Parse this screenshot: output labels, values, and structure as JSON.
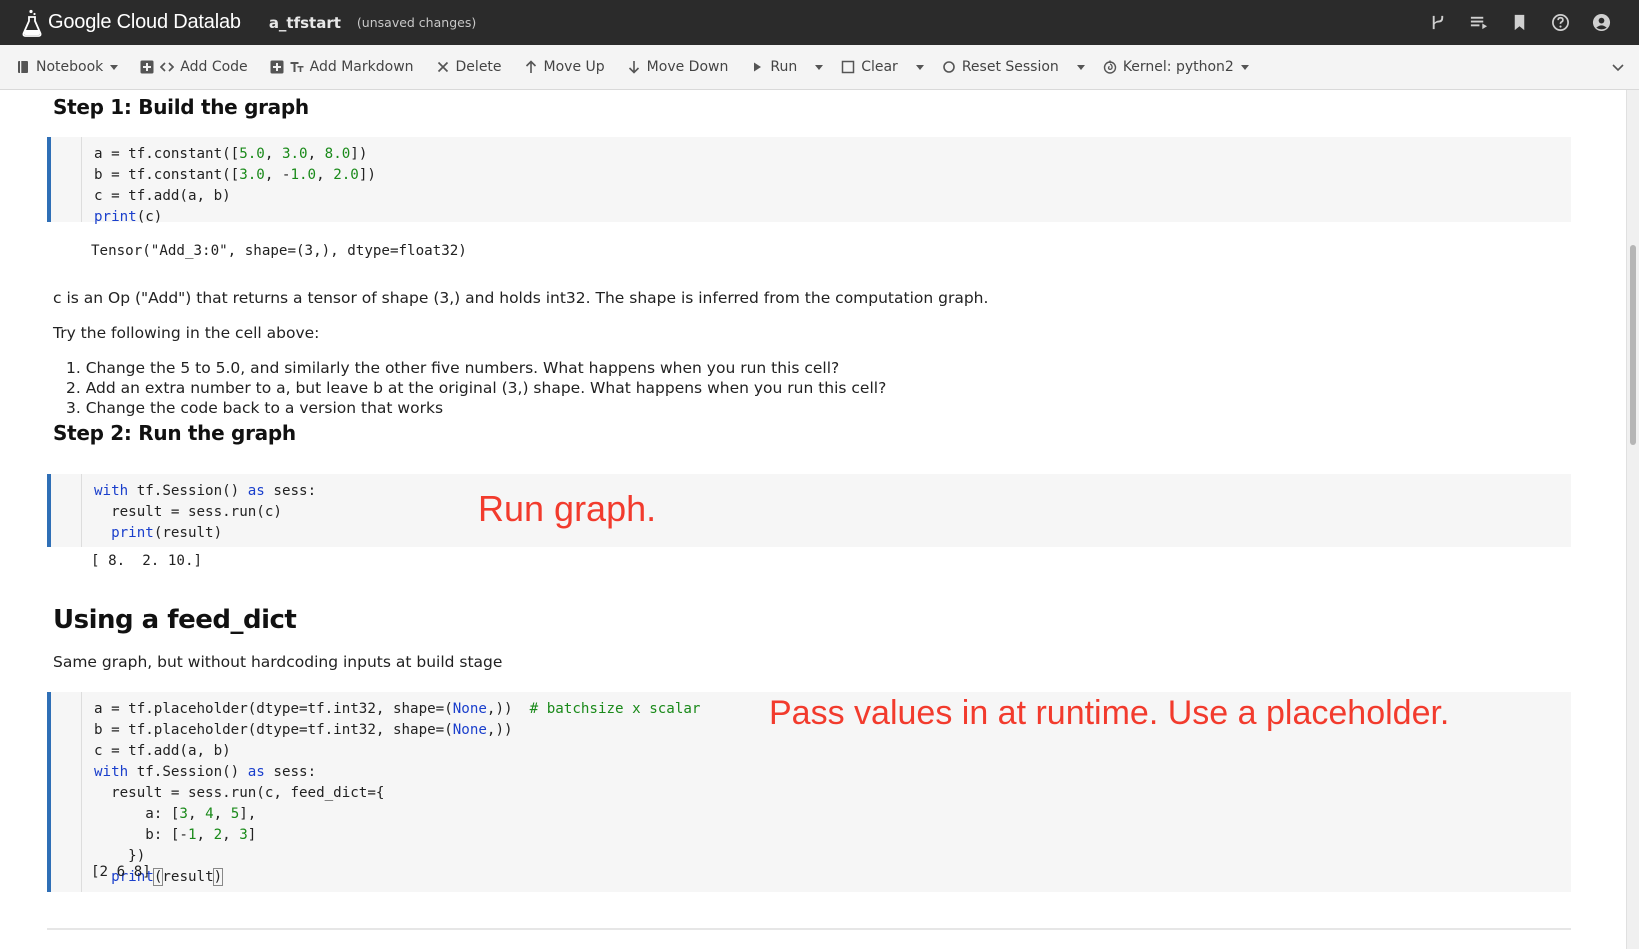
{
  "header": {
    "app_name": "Google Cloud Datalab",
    "notebook_name": "a_tfstart",
    "status": "(unsaved changes)",
    "icons": [
      "ungit-icon",
      "list-icon",
      "bookmark-icon",
      "help-icon",
      "account-icon"
    ]
  },
  "toolbar": {
    "notebook": "Notebook",
    "add_code": "Add Code",
    "add_markdown": "Add Markdown",
    "delete": "Delete",
    "move_up": "Move Up",
    "move_down": "Move Down",
    "run": "Run",
    "clear": "Clear",
    "reset_session": "Reset Session",
    "kernel": "Kernel: python2"
  },
  "step1": {
    "heading": "Step 1: Build the graph",
    "code": [
      "a = tf.constant([5.0, 3.0, 8.0])",
      "b = tf.constant([3.0, -1.0, 2.0])",
      "c = tf.add(a, b)",
      "print(c)"
    ],
    "output": "Tensor(\"Add_3:0\", shape=(3,), dtype=float32)",
    "explanation": "c is an Op (\"Add\") that returns a tensor of shape (3,) and holds int32. The shape is inferred from the computation graph.",
    "try_intro": "Try the following in the cell above:",
    "try_items": [
      "1. Change the 5 to 5.0, and similarly the other five numbers. What happens when you run this cell?",
      "2. Add an extra number to a, but leave b at the original (3,) shape. What happens when you run this cell?",
      "3. Change the code back to a version that works"
    ]
  },
  "step2": {
    "heading": "Step 2: Run the graph",
    "code": [
      "with tf.Session() as sess:",
      "  result = sess.run(c)",
      "  print(result)"
    ],
    "output": "[ 8.  2. 10.]",
    "annotation": "Run graph."
  },
  "feed_dict": {
    "heading": "Using a feed_dict",
    "description": "Same graph, but without hardcoding inputs at build stage",
    "code": [
      "a = tf.placeholder(dtype=tf.int32, shape=(None,))  # batchsize x scalar",
      "b = tf.placeholder(dtype=tf.int32, shape=(None,))",
      "c = tf.add(a, b)",
      "with tf.Session() as sess:",
      "  result = sess.run(c, feed_dict={",
      "      a: [3, 4, 5],",
      "      b: [-1, 2, 3]",
      "    })",
      "  print(result)"
    ],
    "output": "[2 6 8]",
    "annotation": "Pass values in at runtime. Use a placeholder."
  },
  "colors": {
    "header_bg": "#2b2b2b",
    "toolbar_bg": "#f4f4f4",
    "cell_border": "#2f6fb6",
    "keyword": "#1a3fcc",
    "number": "#1a8a1a",
    "annotation": "#f23b2d"
  }
}
